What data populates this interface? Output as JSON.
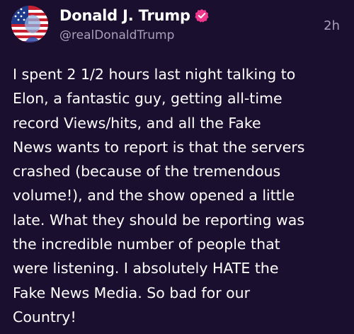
{
  "author": {
    "display_name": "Donald J. Trump",
    "handle": "@realDonaldTrump",
    "verified": true,
    "verified_color": "#f0388d",
    "avatar_icon": "flag-portrait-avatar"
  },
  "post": {
    "time": "2h",
    "text_lines": [
      "I spent 2 1/2 hours last night talking to",
      "Elon, a fantastic guy, getting all-time",
      "record Views/hits, and all the Fake",
      "News wants to report is that the servers",
      "crashed (because of the tremendous",
      "volume!), and the show opened a little",
      "late. What they should be reporting was",
      "the incredible number of people that",
      "were listening. I absolutely HATE the",
      "Fake News Media. So bad for our",
      "Country!"
    ]
  },
  "theme": {
    "background": "#1a0f2e",
    "text_primary": "#ffffff",
    "text_secondary": "#a9a1ba"
  }
}
